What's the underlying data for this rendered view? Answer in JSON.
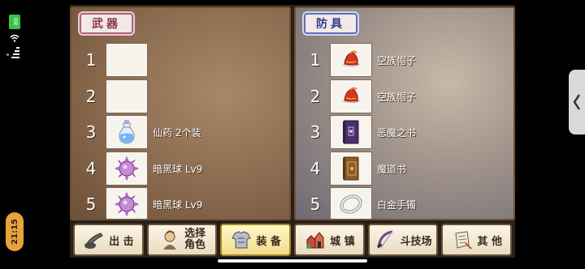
{
  "status": {
    "battery": "80",
    "time": "21:15"
  },
  "colors": {
    "weapon_accent": "#b35f78",
    "armor_accent": "#5f6fb3",
    "battery": "#3ac24a",
    "time_pill": "#e8a23b"
  },
  "weapons": {
    "title": "武器",
    "slots": [
      {
        "num": "1",
        "label": "",
        "icon": ""
      },
      {
        "num": "2",
        "label": "",
        "icon": ""
      },
      {
        "num": "3",
        "label": "仙药 2个装",
        "icon": "potion-icon"
      },
      {
        "num": "4",
        "label": "暗黑球 Lv9",
        "icon": "dark-orb-icon"
      },
      {
        "num": "5",
        "label": "暗黑球 Lv9",
        "icon": "dark-orb-icon"
      }
    ]
  },
  "armor": {
    "title": "防具",
    "slots": [
      {
        "num": "1",
        "label": "空族帽子",
        "icon": "red-hat-icon"
      },
      {
        "num": "2",
        "label": "空族帽子",
        "icon": "red-hat-icon"
      },
      {
        "num": "3",
        "label": "恶魔之书",
        "icon": "purple-book-icon"
      },
      {
        "num": "4",
        "label": "魔道书",
        "icon": "brown-book-icon"
      },
      {
        "num": "5",
        "label": "白金手镯",
        "icon": "bracelet-icon"
      }
    ]
  },
  "nav": [
    {
      "label": "出 击",
      "icon": "sortie-icon"
    },
    {
      "label_line1": "选择",
      "label_line2": "角色",
      "icon": "character-icon"
    },
    {
      "label": "装 备",
      "icon": "armor-icon",
      "active": true
    },
    {
      "label": "城 镇",
      "icon": "town-icon"
    },
    {
      "label": "斗技场",
      "icon": "arena-icon"
    },
    {
      "label": "其 他",
      "icon": "scroll-icon"
    }
  ],
  "back_tab": {
    "icon": "chevron-left-icon"
  }
}
